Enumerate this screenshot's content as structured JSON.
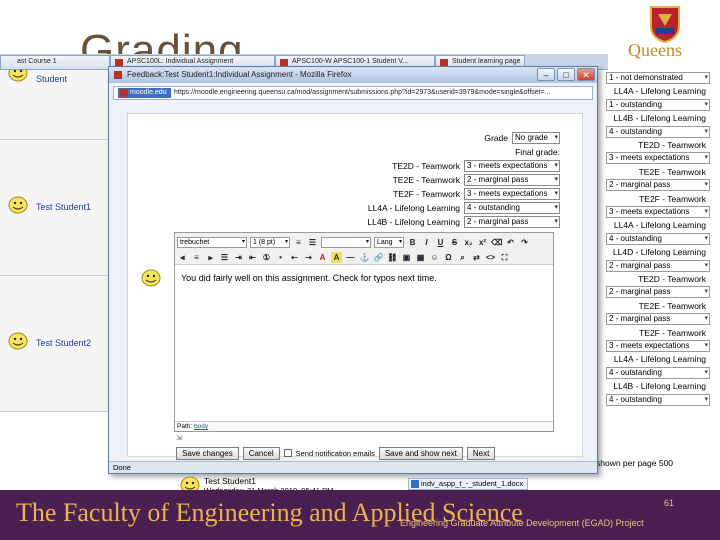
{
  "slide": {
    "title_partial": "Grading",
    "brand": "Queens",
    "footer_title": "The Faculty of Engineering and Applied Science",
    "page_number": "61",
    "project": "Engineering Graduate Attribute Development (EGAD) Project"
  },
  "browser": {
    "tabs": [
      "ast Course 1",
      "APSC100L: Individual Assignment",
      "APSC100-W APSC100-1 Student V...",
      "Student learning page"
    ]
  },
  "grid": {
    "rows": [
      {
        "label": "Student"
      },
      {
        "label": "Test Student1"
      },
      {
        "label": "Test Student2"
      }
    ]
  },
  "right_column": {
    "items": [
      {
        "kind": "select",
        "text": "1 - not demonstrated"
      },
      {
        "kind": "head",
        "text": "LL4A - Lifelong Learning"
      },
      {
        "kind": "select",
        "text": "1 - outstanding"
      },
      {
        "kind": "head",
        "text": "LL4B - Lifelong Learning"
      },
      {
        "kind": "select",
        "text": "4 - outstanding"
      },
      {
        "kind": "head",
        "text": "TE2D - Teamwork"
      },
      {
        "kind": "select",
        "text": "3 - meets expectations"
      },
      {
        "kind": "head",
        "text": "TE2E - Teamwork"
      },
      {
        "kind": "select",
        "text": "2 - marginal pass"
      },
      {
        "kind": "head",
        "text": "TE2F - Teamwork"
      },
      {
        "kind": "select",
        "text": "3 - meets expectations"
      },
      {
        "kind": "head",
        "text": "LL4A - Lifelong Learning"
      },
      {
        "kind": "select",
        "text": "4 - outstanding"
      },
      {
        "kind": "head",
        "text": "LL4D - Lifelong Learning"
      },
      {
        "kind": "select",
        "text": "2 - marginal pass"
      },
      {
        "kind": "head",
        "text": "TE2D - Teamwork"
      },
      {
        "kind": "select",
        "text": "2 - marginal pass"
      },
      {
        "kind": "head",
        "text": "TE2E - Teamwork"
      },
      {
        "kind": "select",
        "text": "2 - marginal pass"
      },
      {
        "kind": "head",
        "text": "TE2F - Teamwork"
      },
      {
        "kind": "select",
        "text": "3 - meets expectations"
      },
      {
        "kind": "head",
        "text": "LL4A - Lifelong Learning"
      },
      {
        "kind": "select",
        "text": "4 - outstanding"
      },
      {
        "kind": "head",
        "text": "LL4B - Lifelong Learning"
      },
      {
        "kind": "select",
        "text": "4 - outstanding"
      }
    ],
    "per_page": "shown per page 500"
  },
  "popup": {
    "window_title": "Feedback:Test Student1:Individual Assignment - Mozilla Firefox",
    "site_badge": "moodle.edu",
    "url": "https://moodle.engineering.queensu.ca/mod/assignment/submissions.php?id=2973&userid=3979&mode=single&offset=...",
    "status": "Done",
    "form": {
      "rows": [
        {
          "label": "Grade",
          "value": "No grade"
        },
        {
          "label": "Final grade:",
          "value": ""
        },
        {
          "label": "TE2D - Teamwork",
          "value": "3 - meets expectations"
        },
        {
          "label": "TE2E - Teamwork",
          "value": "2 - marginal pass"
        },
        {
          "label": "TE2F - Teamwork",
          "value": "3 - meets expectations"
        },
        {
          "label": "LL4A - Lifelong Learning",
          "value": "4 - outstanding"
        },
        {
          "label": "LL4B - Lifelong Learning",
          "value": "2 - marginal pass"
        }
      ]
    },
    "editor": {
      "font": "trebuchet",
      "size": "1 (8 pt)",
      "lang": "Lang",
      "text": "You did fairly well on this assignment. Check for typos next time.",
      "path_label": "Path:",
      "path_tag": "body"
    },
    "actions": {
      "save": "Save changes",
      "cancel": "Cancel",
      "notify": "Send notification emails",
      "save_next": "Save and show next",
      "next": "Next"
    },
    "feedback": {
      "name": "Test Student1",
      "date": "Wednesday, 31 March 2010, 05:41 PM",
      "file": "indv_aspp_t_-_student_1.docx"
    }
  },
  "colors": {
    "footer_bg": "#4b1f52",
    "footer_text": "#e9b64a",
    "title_text": "#6a4f39"
  }
}
